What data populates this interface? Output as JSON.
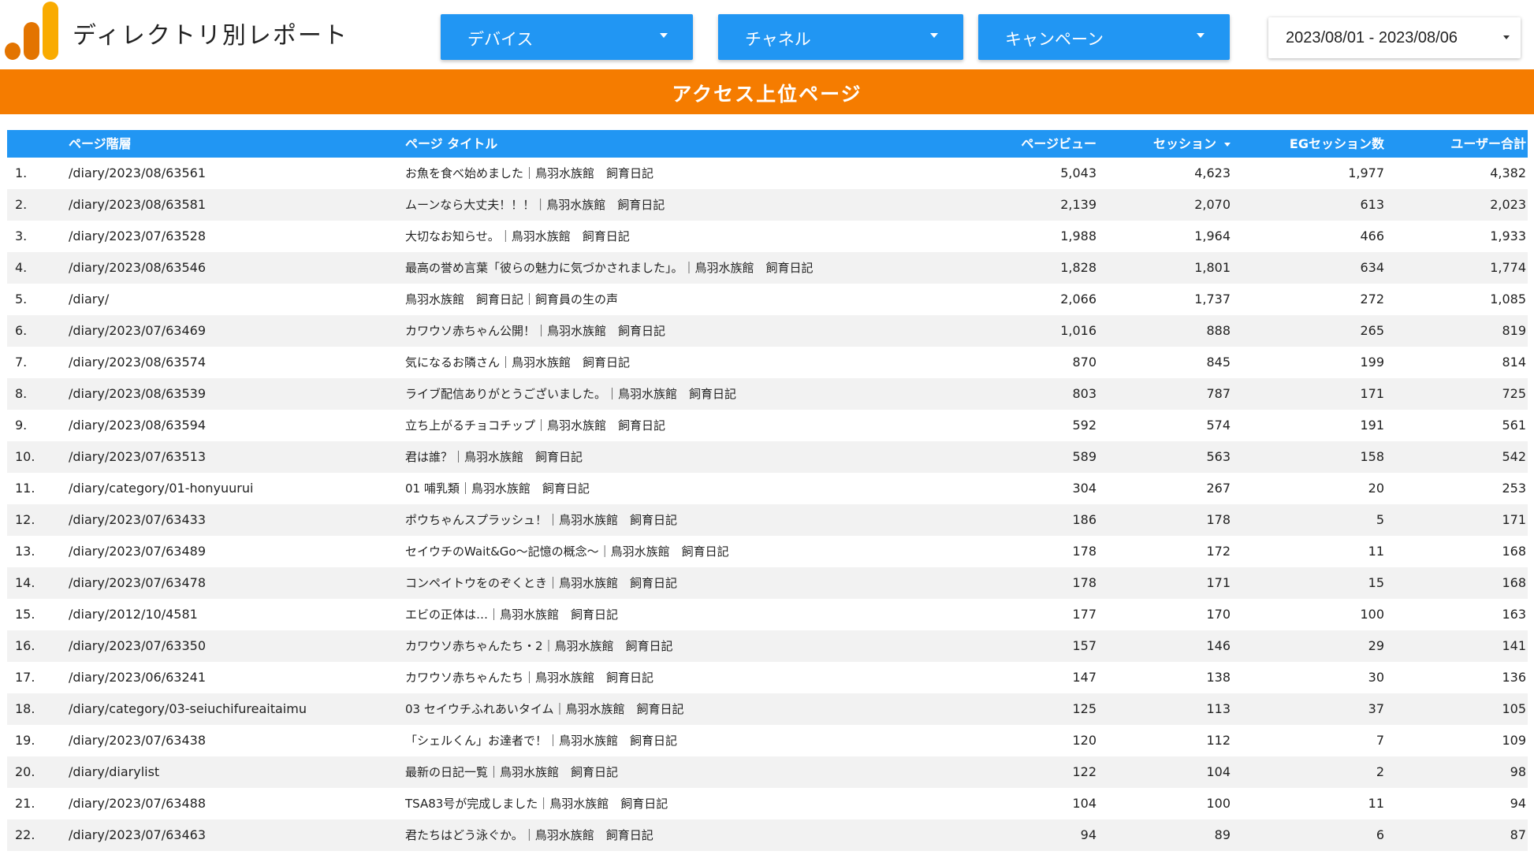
{
  "header": {
    "title": "ディレクトリ別レポート",
    "filters": {
      "device": "デバイス",
      "channel": "チャネル",
      "campaign": "キャンペーン"
    },
    "date_range": "2023/08/01 - 2023/08/06"
  },
  "banner": {
    "title": "アクセス上位ページ"
  },
  "colors": {
    "accent_blue": "#2196f3",
    "banner_orange": "#f57c00",
    "logo_orange": "#e37400",
    "logo_yellow": "#f9ab00"
  },
  "table": {
    "columns": {
      "path": "ページ階層",
      "title": "ページ タイトル",
      "pageviews": "ページビュー",
      "sessions": "セッション",
      "eg_sessions": "EGセッション数",
      "users": "ユーザー合計"
    },
    "sort": {
      "column": "sessions",
      "direction": "desc"
    },
    "rows": [
      {
        "idx": "1.",
        "path": "/diary/2023/08/63561",
        "title": "お魚を食べ始めました｜鳥羽水族館　飼育日記",
        "pv": "5,043",
        "sess": "4,623",
        "eg": "1,977",
        "users": "4,382"
      },
      {
        "idx": "2.",
        "path": "/diary/2023/08/63581",
        "title": "ムーンなら大丈夫！！！｜鳥羽水族館　飼育日記",
        "pv": "2,139",
        "sess": "2,070",
        "eg": "613",
        "users": "2,023"
      },
      {
        "idx": "3.",
        "path": "/diary/2023/07/63528",
        "title": "大切なお知らせ。｜鳥羽水族館　飼育日記",
        "pv": "1,988",
        "sess": "1,964",
        "eg": "466",
        "users": "1,933"
      },
      {
        "idx": "4.",
        "path": "/diary/2023/08/63546",
        "title": "最高の誉め言葉「彼らの魅力に気づかされました」。｜鳥羽水族館　飼育日記",
        "pv": "1,828",
        "sess": "1,801",
        "eg": "634",
        "users": "1,774"
      },
      {
        "idx": "5.",
        "path": "/diary/",
        "title": "鳥羽水族館　飼育日記｜飼育員の生の声",
        "pv": "2,066",
        "sess": "1,737",
        "eg": "272",
        "users": "1,085"
      },
      {
        "idx": "6.",
        "path": "/diary/2023/07/63469",
        "title": "カワウソ赤ちゃん公開！｜鳥羽水族館　飼育日記",
        "pv": "1,016",
        "sess": "888",
        "eg": "265",
        "users": "819"
      },
      {
        "idx": "7.",
        "path": "/diary/2023/08/63574",
        "title": "気になるお隣さん｜鳥羽水族館　飼育日記",
        "pv": "870",
        "sess": "845",
        "eg": "199",
        "users": "814"
      },
      {
        "idx": "8.",
        "path": "/diary/2023/08/63539",
        "title": "ライブ配信ありがとうございました。｜鳥羽水族館　飼育日記",
        "pv": "803",
        "sess": "787",
        "eg": "171",
        "users": "725"
      },
      {
        "idx": "9.",
        "path": "/diary/2023/08/63594",
        "title": "立ち上がるチョコチップ｜鳥羽水族館　飼育日記",
        "pv": "592",
        "sess": "574",
        "eg": "191",
        "users": "561"
      },
      {
        "idx": "10.",
        "path": "/diary/2023/07/63513",
        "title": "君は誰？｜鳥羽水族館　飼育日記",
        "pv": "589",
        "sess": "563",
        "eg": "158",
        "users": "542"
      },
      {
        "idx": "11.",
        "path": "/diary/category/01-honyuurui",
        "title": "01 哺乳類｜鳥羽水族館　飼育日記",
        "pv": "304",
        "sess": "267",
        "eg": "20",
        "users": "253"
      },
      {
        "idx": "12.",
        "path": "/diary/2023/07/63433",
        "title": "ポウちゃんスプラッシュ！｜鳥羽水族館　飼育日記",
        "pv": "186",
        "sess": "178",
        "eg": "5",
        "users": "171"
      },
      {
        "idx": "13.",
        "path": "/diary/2023/07/63489",
        "title": "セイウチのWait&Go～記憶の概念～｜鳥羽水族館　飼育日記",
        "pv": "178",
        "sess": "172",
        "eg": "11",
        "users": "168"
      },
      {
        "idx": "14.",
        "path": "/diary/2023/07/63478",
        "title": "コンペイトウをのぞくとき｜鳥羽水族館　飼育日記",
        "pv": "178",
        "sess": "171",
        "eg": "15",
        "users": "168"
      },
      {
        "idx": "15.",
        "path": "/diary/2012/10/4581",
        "title": "エビの正体は…｜鳥羽水族館　飼育日記",
        "pv": "177",
        "sess": "170",
        "eg": "100",
        "users": "163"
      },
      {
        "idx": "16.",
        "path": "/diary/2023/07/63350",
        "title": "カワウソ赤ちゃんたち・2｜鳥羽水族館　飼育日記",
        "pv": "157",
        "sess": "146",
        "eg": "29",
        "users": "141"
      },
      {
        "idx": "17.",
        "path": "/diary/2023/06/63241",
        "title": "カワウソ赤ちゃんたち｜鳥羽水族館　飼育日記",
        "pv": "147",
        "sess": "138",
        "eg": "30",
        "users": "136"
      },
      {
        "idx": "18.",
        "path": "/diary/category/03-seiuchifureaitaimu",
        "title": "03 セイウチふれあいタイム｜鳥羽水族館　飼育日記",
        "pv": "125",
        "sess": "113",
        "eg": "37",
        "users": "105"
      },
      {
        "idx": "19.",
        "path": "/diary/2023/07/63438",
        "title": "「シェルくん」お達者で！｜鳥羽水族館　飼育日記",
        "pv": "120",
        "sess": "112",
        "eg": "7",
        "users": "109"
      },
      {
        "idx": "20.",
        "path": "/diary/diarylist",
        "title": "最新の日記一覧｜鳥羽水族館　飼育日記",
        "pv": "122",
        "sess": "104",
        "eg": "2",
        "users": "98"
      },
      {
        "idx": "21.",
        "path": "/diary/2023/07/63488",
        "title": "TSA83号が完成しました｜鳥羽水族館　飼育日記",
        "pv": "104",
        "sess": "100",
        "eg": "11",
        "users": "94"
      },
      {
        "idx": "22.",
        "path": "/diary/2023/07/63463",
        "title": "君たちはどう泳ぐか。｜鳥羽水族館　飼育日記",
        "pv": "94",
        "sess": "89",
        "eg": "6",
        "users": "87"
      }
    ]
  }
}
